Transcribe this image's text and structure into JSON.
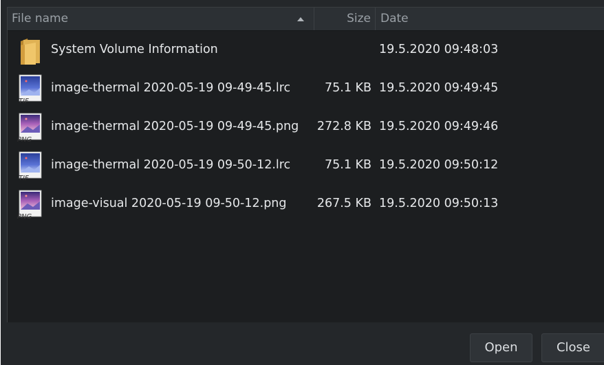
{
  "columns": {
    "name": "File name",
    "size": "Size",
    "date": "Date"
  },
  "files": [
    {
      "name": "System Volume Information",
      "size": "",
      "date": "19.5.2020 09:48:03",
      "icon": "folder-icon"
    },
    {
      "name": "image-thermal 2020-05-19 09-49-45.lrc",
      "size": "75.1 KB",
      "date": "19.5.2020 09:49:45",
      "icon": "tif-file-icon",
      "icon_label": "TIF"
    },
    {
      "name": "image-thermal 2020-05-19 09-49-45.png",
      "size": "272.8 KB",
      "date": "19.5.2020 09:49:46",
      "icon": "png-file-icon",
      "icon_label": "PNG"
    },
    {
      "name": "image-thermal 2020-05-19 09-50-12.lrc",
      "size": "75.1 KB",
      "date": "19.5.2020 09:50:12",
      "icon": "tif-file-icon",
      "icon_label": "TIF"
    },
    {
      "name": "image-visual 2020-05-19 09-50-12.png",
      "size": "267.5 KB",
      "date": "19.5.2020 09:50:13",
      "icon": "png-file-icon",
      "icon_label": "PNG"
    }
  ],
  "buttons": {
    "open": "Open",
    "close": "Close"
  },
  "colors": {
    "background": "#24272a",
    "list_background": "#1c1e20",
    "header_background": "#2c3034",
    "text": "#e6e8ea",
    "folder": "#d9a94a"
  }
}
